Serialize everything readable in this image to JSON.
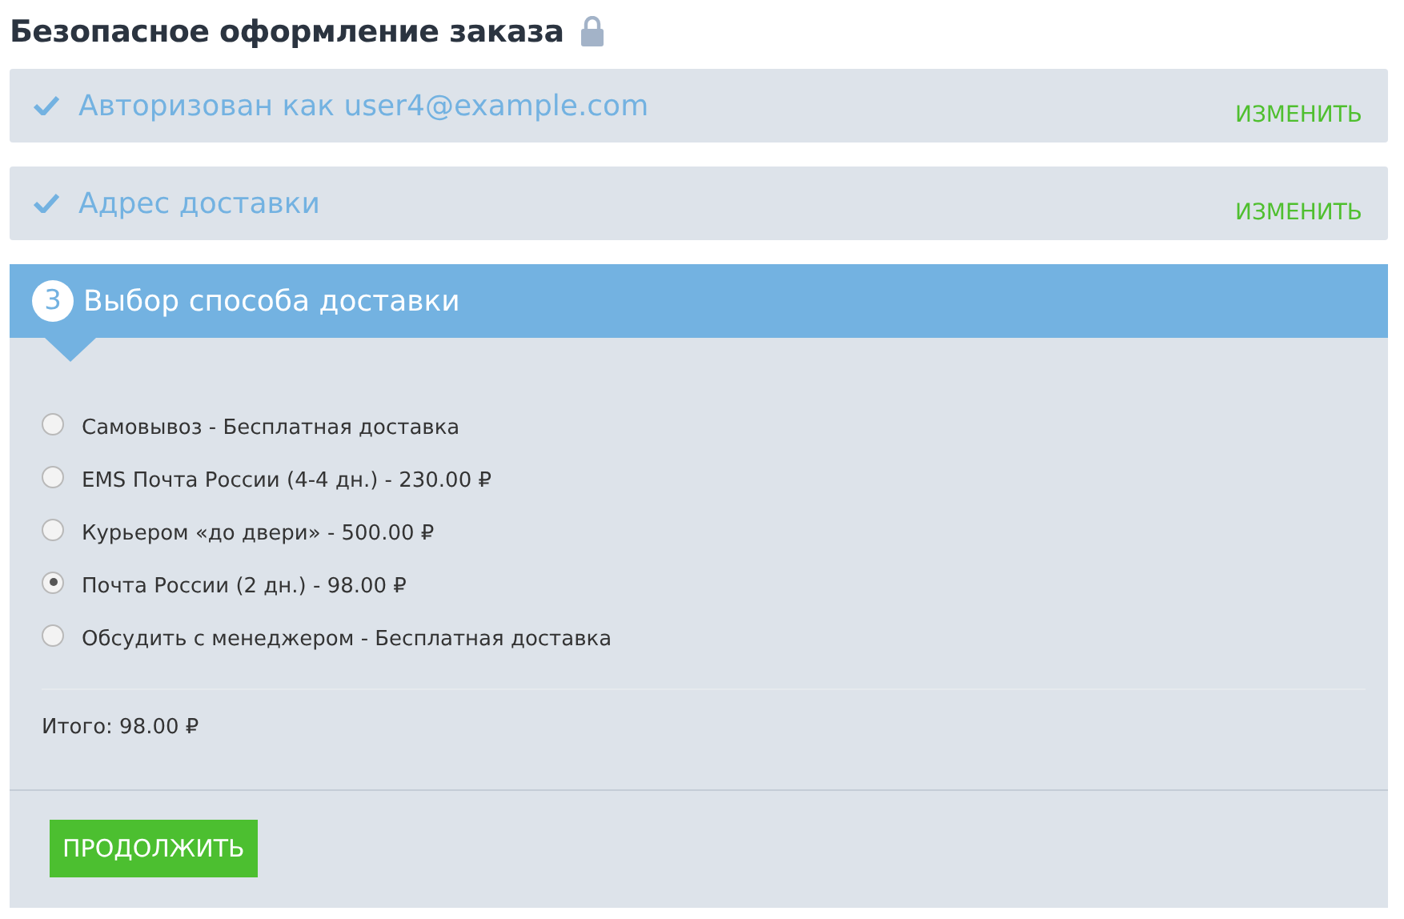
{
  "title": "Безопасное оформление заказа",
  "steps": [
    {
      "label": "Авторизован как user4@example.com",
      "done": true,
      "action": "ИЗМЕНИТЬ"
    },
    {
      "label": "Адрес доставки",
      "done": true,
      "action": "ИЗМЕНИТЬ"
    }
  ],
  "current_step": {
    "number": "3",
    "title": "Выбор способа доставки",
    "options": [
      {
        "label": "Самовывоз - Бесплатная доставка",
        "selected": false
      },
      {
        "label": "EMS Почта России (4-4 дн.) - 230.00 ₽",
        "selected": false
      },
      {
        "label": "Курьером «до двери» - 500.00 ₽",
        "selected": false
      },
      {
        "label": "Почта России (2 дн.) - 98.00 ₽",
        "selected": true
      },
      {
        "label": "Обсудить с менеджером - Бесплатная доставка",
        "selected": false
      }
    ],
    "total": "Итого: 98.00 ₽",
    "button": "ПРОДОЛЖИТЬ"
  }
}
